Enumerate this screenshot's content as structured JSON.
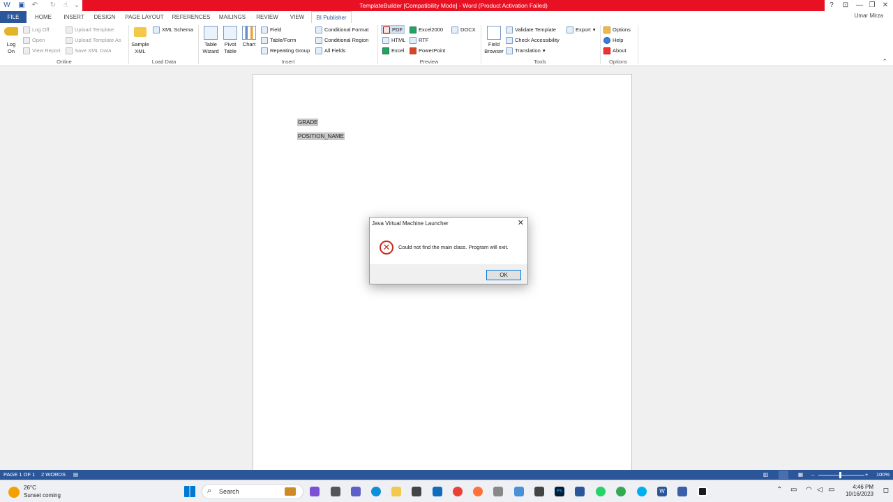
{
  "window": {
    "title": "TemplateBuilder [Compatibility Mode] - Word (Product Activation Failed)",
    "user": "Umar Mirza",
    "controls": {
      "help": "?",
      "ribbon_display": "⊡",
      "minimize": "—",
      "restore": "❐",
      "close": "✕"
    }
  },
  "tabs": [
    "FILE",
    "HOME",
    "INSERT",
    "DESIGN",
    "PAGE LAYOUT",
    "REFERENCES",
    "MAILINGS",
    "REVIEW",
    "VIEW",
    "BI Publisher"
  ],
  "ribbon": {
    "online": {
      "label": "Online",
      "log_on": "Log On",
      "log_off": "Log Off",
      "open": "Open",
      "view_report": "View Report",
      "upload_template": "Upload Template",
      "upload_template_as": "Upload Template As",
      "save_xml_data": "Save XML Data"
    },
    "load_data": {
      "label": "Load Data",
      "sample_xml": "Sample XML",
      "xml_schema": "XML Schema"
    },
    "insert": {
      "label": "Insert",
      "table_wizard": "Table Wizard",
      "pivot_table": "Pivot Table",
      "chart": "Chart",
      "field": "Field",
      "table_form": "Table/Form",
      "repeating_group": "Repeating Group",
      "conditional_format": "Conditional Format",
      "conditional_region": "Conditional Region",
      "all_fields": "All Fields"
    },
    "preview": {
      "label": "Preview",
      "pdf": "PDF",
      "html": "HTML",
      "excel": "Excel",
      "excel2000": "Excel2000",
      "rtf": "RTF",
      "powerpoint": "PowerPoint",
      "docx": "DOCX"
    },
    "tools": {
      "label": "Tools",
      "field_browser": "Field Browser",
      "validate_template": "Validate Template",
      "check_accessibility": "Check Accessibility",
      "translation": "Translation",
      "export": "Export"
    },
    "options": {
      "label": "Options",
      "options": "Options",
      "help": "Help",
      "about": "About"
    }
  },
  "document": {
    "fields": [
      "GRADE",
      "POSITION_NAME"
    ]
  },
  "dialog": {
    "title": "Java Virtual Machine Launcher",
    "message": "Could not find the main class.  Program will exit.",
    "ok": "OK"
  },
  "status": {
    "page": "PAGE 1 OF 1",
    "words": "2 WORDS",
    "zoom": "100%"
  },
  "taskbar": {
    "temperature": "26°C",
    "weather": "Sunset coming",
    "search_label": "Search",
    "time": "4:46 PM",
    "date": "10/16/2023"
  },
  "colors": {
    "word_blue": "#2b579a",
    "title_red": "#e81123",
    "error_red": "#c42b1c"
  }
}
